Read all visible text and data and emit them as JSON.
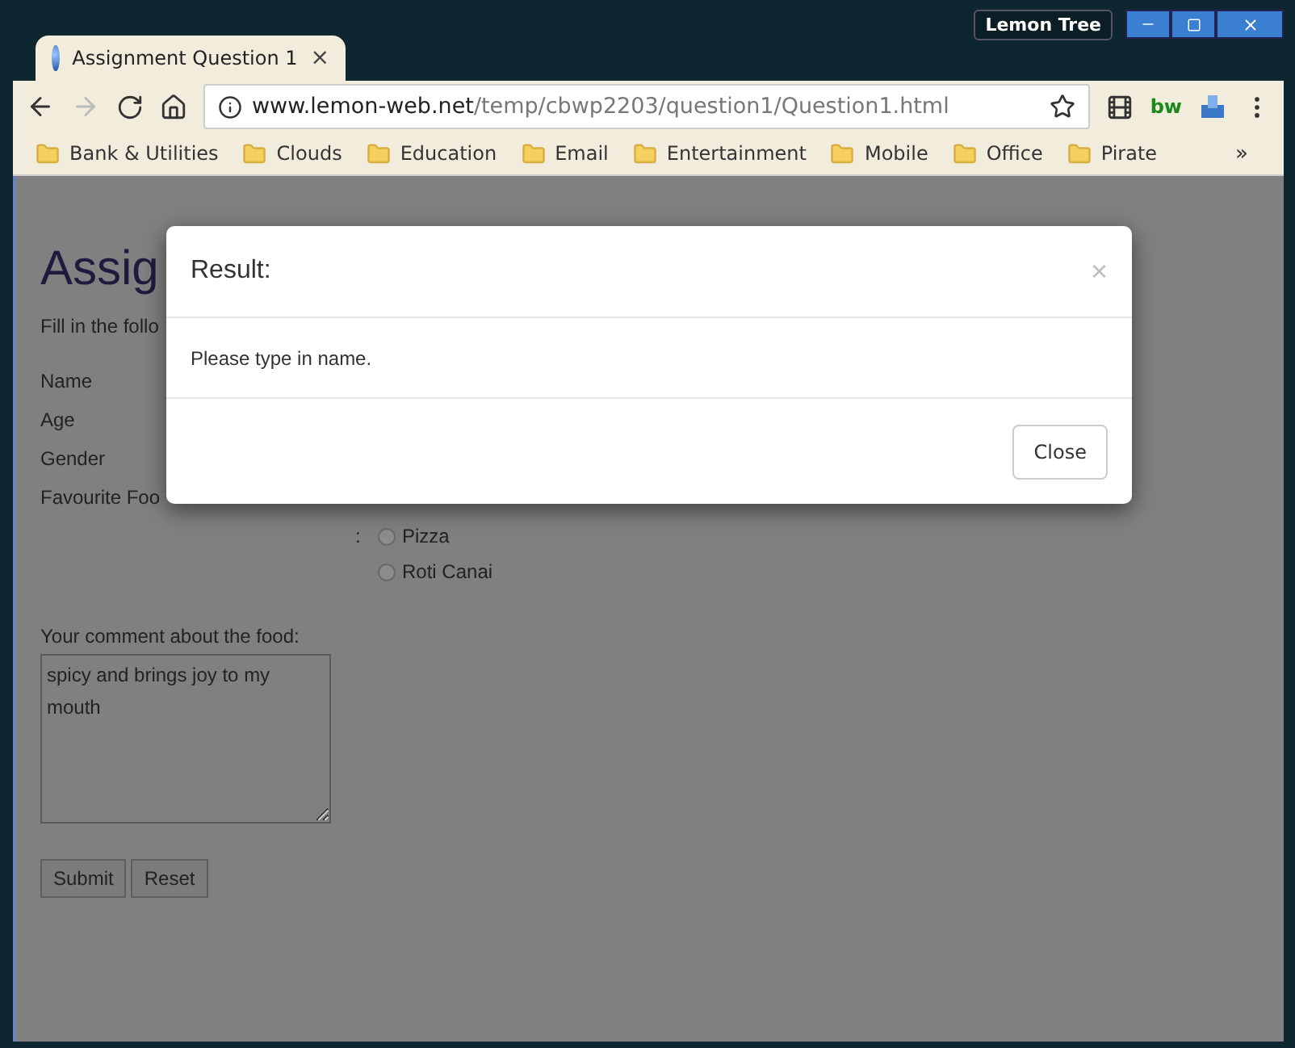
{
  "window": {
    "user_badge": "Lemon Tree"
  },
  "tabs": [
    {
      "title": "Assignment Question 1",
      "close": "×",
      "selected": true
    }
  ],
  "navigation": {
    "forward_disabled": true
  },
  "address": {
    "domain": "www.lemon-web.net",
    "path": "/temp/cbwp2203/question1/Question1.html"
  },
  "extension_label": "bw",
  "bookmarks": [
    "Bank & Utilities",
    "Clouds",
    "Education",
    "Email",
    "Entertainment",
    "Mobile",
    "Office",
    "Pirate"
  ],
  "bookmarks_overflow": "»",
  "page": {
    "title": "Assig",
    "intro": "Fill in the follo",
    "fields": [
      {
        "label": "Name"
      },
      {
        "label": "Age"
      },
      {
        "label": "Gender"
      },
      {
        "label": "Favourite Foo"
      }
    ],
    "food_separator": ":",
    "food_options": [
      {
        "label": "Pizza",
        "selected": false
      },
      {
        "label": "Roti Canai",
        "selected": false
      }
    ],
    "comment_label": "Your comment about the food:",
    "comment_value": "spicy and brings joy to my mouth",
    "buttons": [
      "Submit",
      "Reset"
    ]
  },
  "modal": {
    "title": "Result:",
    "close": "×",
    "message": "Please type in name.",
    "button": "Close"
  }
}
